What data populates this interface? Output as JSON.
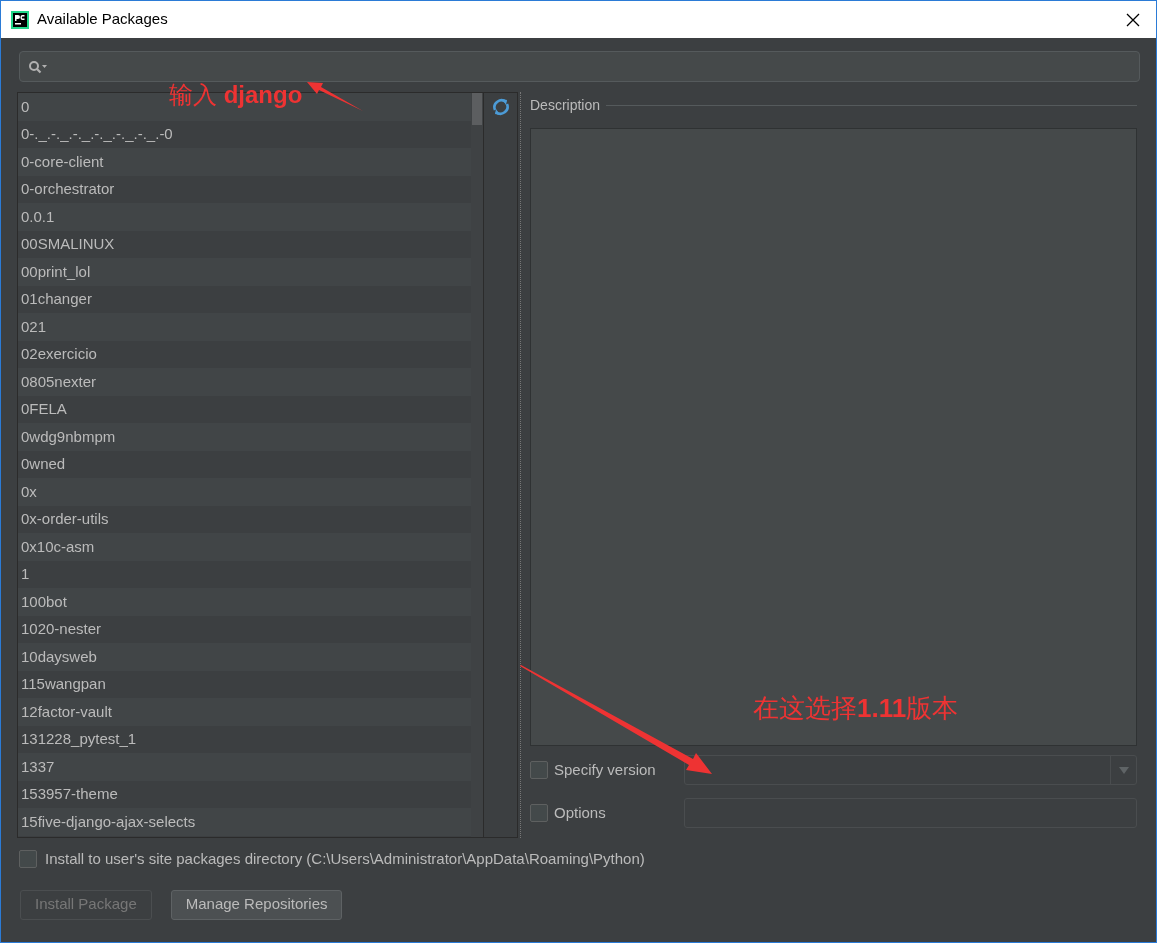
{
  "window": {
    "title": "Available Packages"
  },
  "packages": [
    "0",
    "0-._.-._.-._.-._.-._.-._.-0",
    "0-core-client",
    "0-orchestrator",
    "0.0.1",
    "00SMALINUX",
    "00print_lol",
    "01changer",
    "021",
    "02exercicio",
    "0805nexter",
    "0FELA",
    "0wdg9nbmpm",
    "0wned",
    "0x",
    "0x-order-utils",
    "0x10c-asm",
    "1",
    "100bot",
    "1020-nester",
    "10daysweb",
    "115wangpan",
    "12factor-vault",
    "131228_pytest_1",
    "1337",
    "153957-theme",
    "15five-django-ajax-selects"
  ],
  "description": {
    "title": "Description"
  },
  "specify_version": {
    "label": "Specify version",
    "checked": false
  },
  "options": {
    "label": "Options",
    "checked": false
  },
  "install_to_user": {
    "label": "Install to user's site packages directory (C:\\Users\\Administrator\\AppData\\Roaming\\Python)",
    "checked": false
  },
  "buttons": [
    {
      "label": "Install Package",
      "disabled": true
    },
    {
      "label": "Manage Repositories",
      "disabled": false
    }
  ],
  "annotations": [
    {
      "text": "输入 **django**"
    },
    {
      "text": "在这选择**1.11**版本"
    }
  ]
}
